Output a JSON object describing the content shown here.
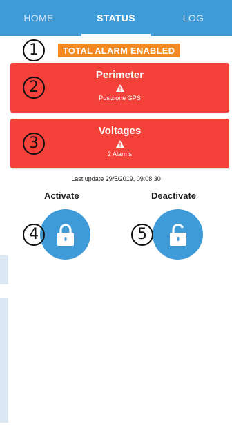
{
  "tabs": [
    {
      "label": "HOME"
    },
    {
      "label": "STATUS"
    },
    {
      "label": "LOG"
    }
  ],
  "callouts": [
    "1",
    "2",
    "3",
    "4",
    "5"
  ],
  "alarm_status": "TOTAL ALARM ENABLED",
  "cards": [
    {
      "title": "Perimeter",
      "subtitle": "Posizione GPS",
      "icon": "warning-icon"
    },
    {
      "title": "Voltages",
      "subtitle": "2 Alarms",
      "icon": "warning-icon"
    }
  ],
  "last_update": "Last update 29/5/2019, 09:08:30",
  "actions": {
    "activate_label": "Activate",
    "deactivate_label": "Deactivate",
    "activate_icon": "lock-closed-icon",
    "deactivate_icon": "lock-open-icon"
  },
  "colors": {
    "primary": "#3f9ad8",
    "alarm_card": "#f4423a",
    "alarm_badge": "#f48a1f"
  }
}
